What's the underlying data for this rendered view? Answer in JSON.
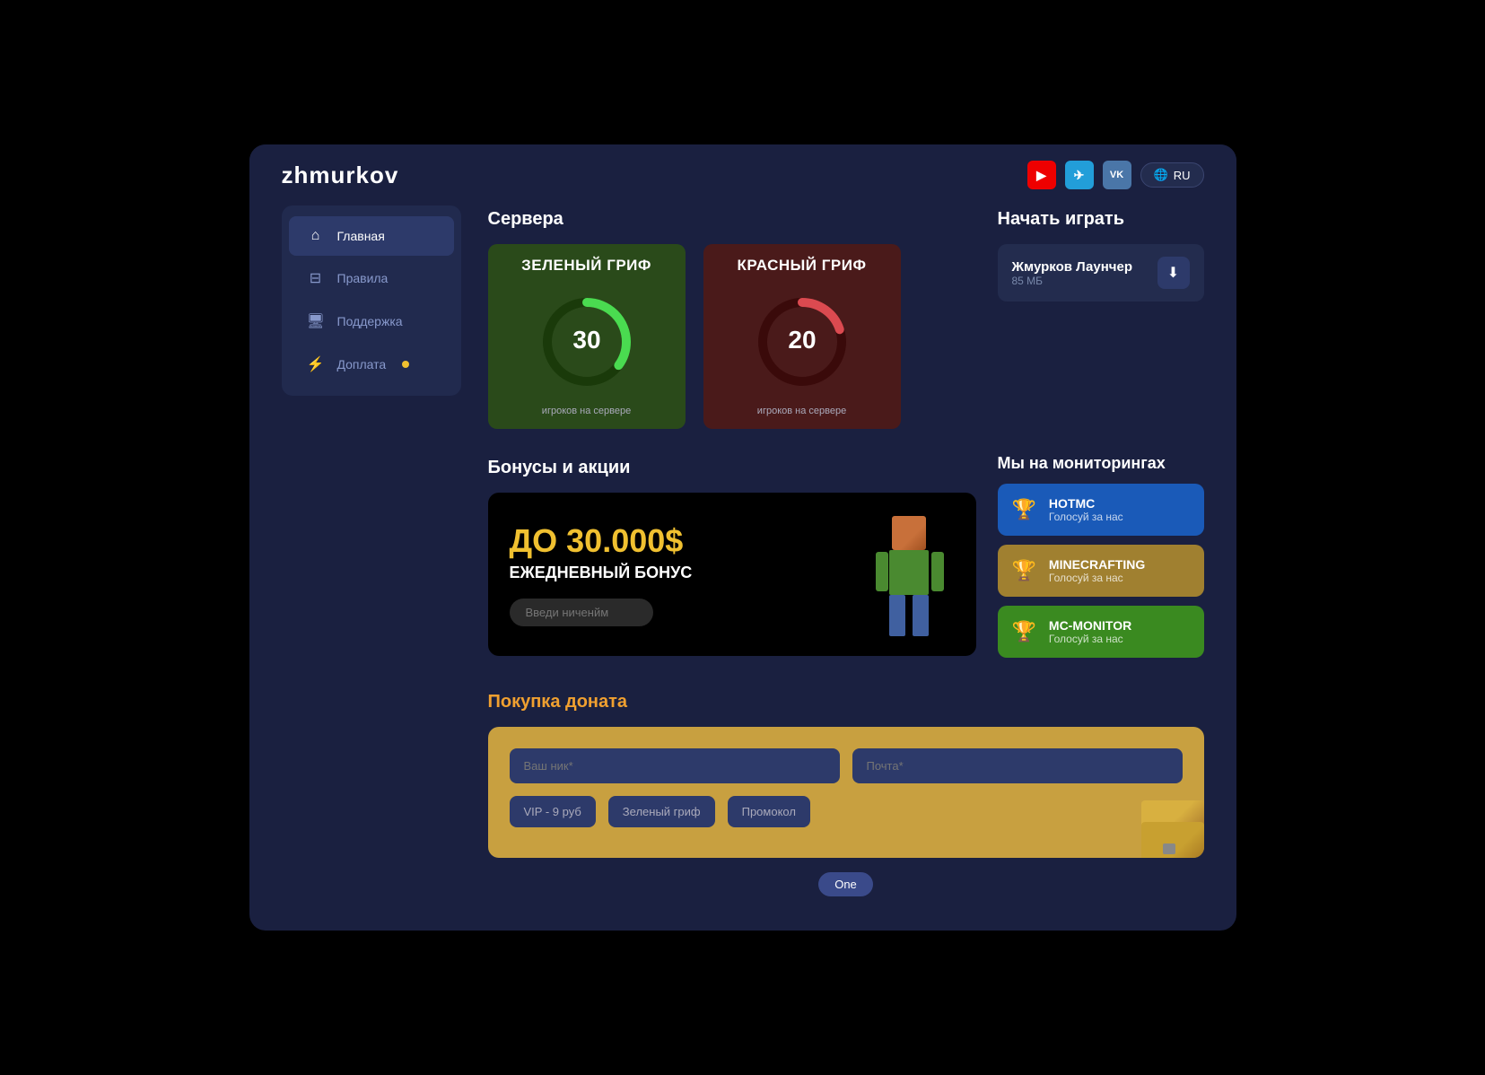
{
  "header": {
    "logo": "zhmurkov",
    "social": [
      {
        "name": "youtube",
        "label": "▶",
        "class": "yt"
      },
      {
        "name": "telegram",
        "label": "✈",
        "class": "tg"
      },
      {
        "name": "vk",
        "label": "vk",
        "class": "vk"
      }
    ],
    "language": "RU"
  },
  "sidebar": {
    "items": [
      {
        "id": "home",
        "label": "Главная",
        "icon": "⌂",
        "active": true,
        "badge": false
      },
      {
        "id": "rules",
        "label": "Правила",
        "icon": "☰",
        "active": false,
        "badge": false
      },
      {
        "id": "support",
        "label": "Поддержка",
        "icon": "🖥",
        "active": false,
        "badge": false
      },
      {
        "id": "topup",
        "label": "Доплата",
        "icon": "⚡",
        "active": false,
        "badge": true
      }
    ]
  },
  "servers": {
    "title": "Сервера",
    "items": [
      {
        "id": "green",
        "name": "ЗЕЛЕНЫЙ ГРИФ",
        "class": "green",
        "players": 30,
        "max": 100,
        "footer": "игроков на сервере",
        "color": "#4adb50",
        "bg": "#2a4a1a"
      },
      {
        "id": "red",
        "name": "КРАСНЫЙ ГРИФ",
        "class": "red",
        "players": 20,
        "max": 100,
        "footer": "игроков на сервере",
        "color": "#db4a50",
        "bg": "#4a1a1a"
      }
    ]
  },
  "start_play": {
    "title": "Начать играть",
    "launcher": {
      "name": "Жмурков Лаунчер",
      "size": "85 МБ",
      "icon": "⬇"
    }
  },
  "bonuses": {
    "title": "Бонусы и акции",
    "amount": "ДО 30.000$",
    "subtitle": "ЕЖЕДНЕВНЫЙ БОНУС",
    "input_placeholder": "Введи ниченйм"
  },
  "monitoring": {
    "title": "Мы на мониторингах",
    "items": [
      {
        "name": "HOTMC",
        "sub": "Голосуй за нас",
        "class": "blue"
      },
      {
        "name": "MINECRAFTING",
        "sub": "Голосуй за нас",
        "class": "gold"
      },
      {
        "name": "MC-MONITOR",
        "sub": "Голосуй за нас",
        "class": "green-mon"
      }
    ]
  },
  "donat": {
    "title": "Покупка доната",
    "inputs": [
      {
        "id": "nick",
        "placeholder": "Ваш ник*"
      },
      {
        "id": "email",
        "placeholder": "Почта*"
      }
    ],
    "options": [
      {
        "id": "vip",
        "label": "VIP - 9 руб"
      },
      {
        "id": "green-grif",
        "label": "Зеленый гриф"
      },
      {
        "id": "promo",
        "label": "Промокол"
      }
    ]
  },
  "pagination": {
    "current": 1,
    "label": "One"
  }
}
